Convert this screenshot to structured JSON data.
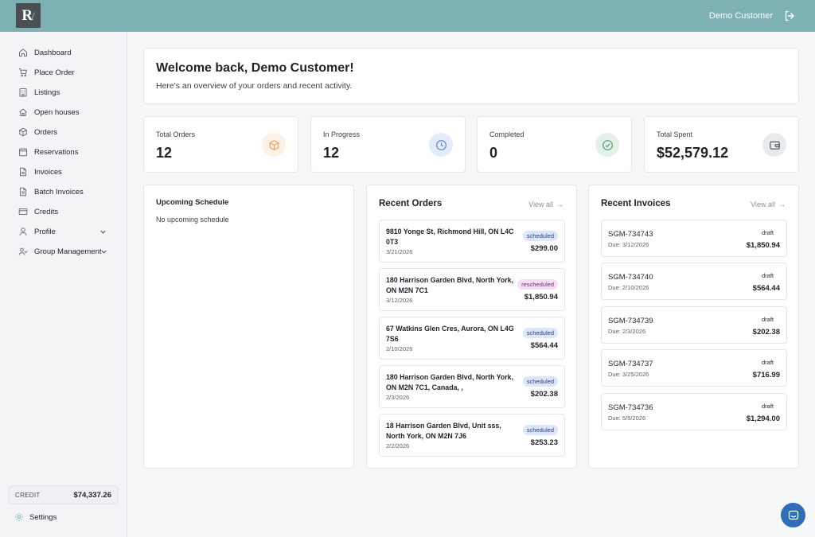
{
  "app": {
    "logo_text": "R",
    "user_name": "Demo Customer",
    "accent_color": "#7eb1b3"
  },
  "sidebar": {
    "items": [
      {
        "label": "Dashboard",
        "icon": "home-icon"
      },
      {
        "label": "Place Order",
        "icon": "cart-icon"
      },
      {
        "label": "Listings",
        "icon": "building-icon"
      },
      {
        "label": "Open houses",
        "icon": "house-icon"
      },
      {
        "label": "Orders",
        "icon": "box-icon"
      },
      {
        "label": "Reservations",
        "icon": "calendar-icon"
      },
      {
        "label": "Invoices",
        "icon": "file-icon"
      },
      {
        "label": "Batch Invoices",
        "icon": "files-icon"
      },
      {
        "label": "Credits",
        "icon": "card-icon"
      },
      {
        "label": "Profile",
        "icon": "user-icon"
      },
      {
        "label": "Group Management",
        "icon": "users-icon"
      }
    ],
    "credit_label": "CREDIT",
    "credit_value": "$74,337.26",
    "settings_label": "Settings"
  },
  "welcome": {
    "title": "Welcome back, Demo Customer!",
    "subtitle": "Here's an overview of your orders and recent activity."
  },
  "stats": [
    {
      "label": "Total Orders",
      "value": "12",
      "icon": "box-icon",
      "color": "#f0a05a",
      "bg": "#fdf0e4"
    },
    {
      "label": "In Progress",
      "value": "12",
      "icon": "clock-icon",
      "color": "#5b7fc7",
      "bg": "#e4ebf8"
    },
    {
      "label": "Completed",
      "value": "0",
      "icon": "check-circle-icon",
      "color": "#4f9a6a",
      "bg": "#e3f1e8"
    },
    {
      "label": "Total Spent",
      "value": "$52,579.12",
      "icon": "wallet-icon",
      "color": "#4a4f54",
      "bg": "#e8ebee"
    }
  ],
  "schedule": {
    "title": "Upcoming Schedule",
    "empty_text": "No upcoming schedule"
  },
  "orders": {
    "title": "Recent Orders",
    "view_all": "View all",
    "items": [
      {
        "address": "9810 Yonge St, Richmond Hill, ON L4C 0T3",
        "date": "3/21/2026",
        "status": "scheduled",
        "amount": "$299.00"
      },
      {
        "address": "180 Harrison Garden Blvd, North York, ON M2N 7C1",
        "date": "3/12/2026",
        "status": "rescheduled",
        "amount": "$1,850.94"
      },
      {
        "address": "67 Watkins Glen Cres, Aurora, ON L4G 7S6",
        "date": "2/10/2026",
        "status": "scheduled",
        "amount": "$564.44"
      },
      {
        "address": "180 Harrison Garden Blvd, North York, ON M2N 7C1, Canada, ,",
        "date": "2/3/2026",
        "status": "scheduled",
        "amount": "$202.38"
      },
      {
        "address": "18 Harrison Garden Blvd, Unit sss, North York, ON M2N 7J6",
        "date": "2/2/2026",
        "status": "scheduled",
        "amount": "$253.23"
      }
    ]
  },
  "invoices": {
    "title": "Recent Invoices",
    "view_all": "View all",
    "items": [
      {
        "number": "SGM-734743",
        "due": "Due: 3/12/2026",
        "status": "draft",
        "amount": "$1,850.94"
      },
      {
        "number": "SGM-734740",
        "due": "Due: 2/10/2026",
        "status": "draft",
        "amount": "$564.44"
      },
      {
        "number": "SGM-734739",
        "due": "Due: 2/3/2026",
        "status": "draft",
        "amount": "$202.38"
      },
      {
        "number": "SGM-734737",
        "due": "Due: 3/25/2026",
        "status": "draft",
        "amount": "$716.99"
      },
      {
        "number": "SGM-734736",
        "due": "Due: 5/5/2026",
        "status": "draft",
        "amount": "$1,294.00"
      }
    ]
  }
}
